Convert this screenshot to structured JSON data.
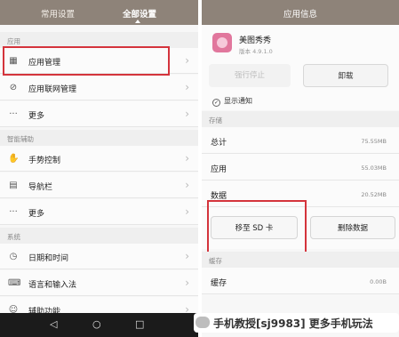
{
  "left": {
    "tabs": [
      "常用设置",
      "全部设置"
    ],
    "sections": {
      "apps": "应用",
      "assist": "智能辅助",
      "system": "系统"
    },
    "rows": [
      {
        "label": "应用管理",
        "icon": "app-grid-icon"
      },
      {
        "label": "应用联网管理",
        "icon": "network-icon"
      },
      {
        "label": "更多",
        "icon": "more-dots-icon"
      },
      {
        "label": "手势控制",
        "icon": "gesture-icon"
      },
      {
        "label": "导航栏",
        "icon": "navbar-icon"
      },
      {
        "label": "更多",
        "icon": "more-dots-icon"
      },
      {
        "label": "日期和时间",
        "icon": "clock-icon"
      },
      {
        "label": "语言和输入法",
        "icon": "keyboard-icon"
      },
      {
        "label": "辅助功能",
        "icon": "accessibility-icon"
      }
    ]
  },
  "right": {
    "title": "应用信息",
    "app": {
      "name": "美图秀秀",
      "version": "版本 4.9.1.0"
    },
    "force_stop": "强行停止",
    "uninstall": "卸载",
    "notify": "显示通知",
    "storage_section": "存储",
    "storage": [
      {
        "key": "总计",
        "value": "75.55MB"
      },
      {
        "key": "应用",
        "value": "55.03MB"
      },
      {
        "key": "数据",
        "value": "20.52MB"
      }
    ],
    "move_sd": "移至 SD 卡",
    "clear_data": "删除数据",
    "cache_section": "缓存",
    "cache": {
      "key": "缓存",
      "value": "0.00B"
    }
  },
  "watermark": "手机教授[sj9983] 更多手机玩法",
  "colors": {
    "titlebar": "#8e8379",
    "highlight": "#d4343c"
  }
}
